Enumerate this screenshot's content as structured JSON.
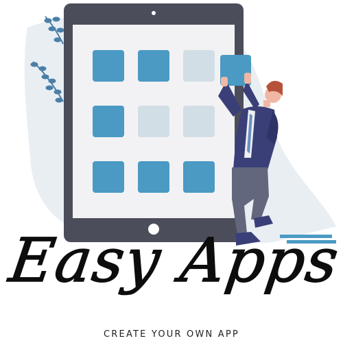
{
  "brand": {
    "title": "Easy Apps",
    "tagline": "CREATE YOUR OWN APP"
  },
  "tablet": {
    "grid": [
      {
        "state": "filled"
      },
      {
        "state": "filled"
      },
      {
        "state": "empty"
      },
      {
        "state": "filled"
      },
      {
        "state": "empty"
      },
      {
        "state": "empty"
      },
      {
        "state": "filled"
      },
      {
        "state": "filled"
      },
      {
        "state": "filled"
      }
    ]
  },
  "colors": {
    "tile_filled": "#4a9ac4",
    "tile_empty": "#d2dee6",
    "tablet_frame": "#4b4d5a",
    "screen": "#f2f2f4",
    "background_blob": "#e9eef3",
    "leaf": "#4a7fa8",
    "suit": "#3b3f78",
    "hair": "#b7523a",
    "skin": "#f0b7a4",
    "trousers": "#63677d",
    "title_ink": "#0d0d0d"
  },
  "icons": [
    "leaf-branch-icon",
    "app-tile-icon",
    "home-button-icon",
    "camera-dot-icon"
  ]
}
